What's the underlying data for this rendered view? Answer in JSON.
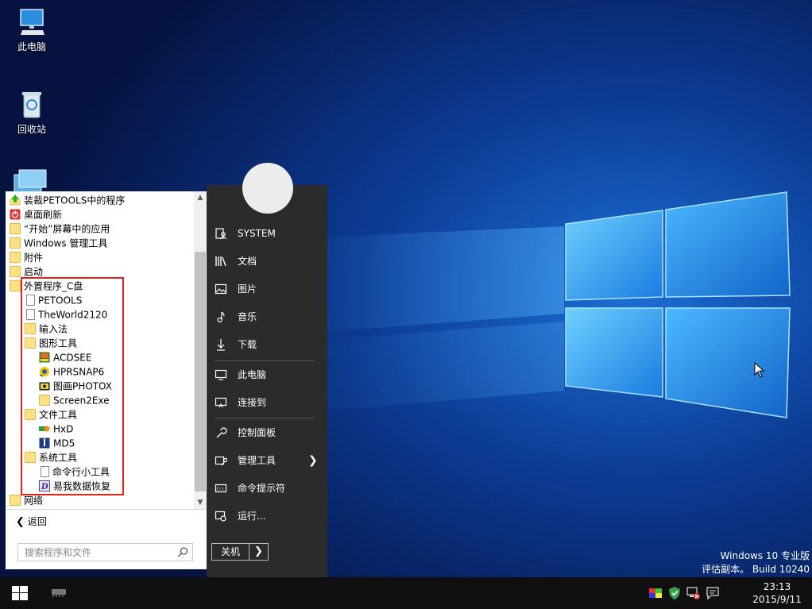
{
  "desktop": {
    "icons": [
      {
        "label": "此电脑",
        "icon": "computer-icon"
      },
      {
        "label": "回收站",
        "icon": "recycle-bin-icon"
      }
    ],
    "watermark": {
      "line1": "Windows 10 专业版",
      "line2": "评估副本。 Build 10240"
    }
  },
  "start_menu": {
    "left": {
      "items": [
        {
          "label": "装裁PETOOLS中的程序",
          "icon": "green-arrow-icon"
        },
        {
          "label": "桌面刷新",
          "icon": "red-power-icon"
        },
        {
          "label": "“开始”屏幕中的应用",
          "icon": "folder-icon"
        },
        {
          "label": "Windows 管理工具",
          "icon": "folder-icon"
        },
        {
          "label": "附件",
          "icon": "folder-icon"
        },
        {
          "label": "启动",
          "icon": "folder-icon"
        },
        {
          "label": "外置程序_C盘",
          "icon": "folder-icon"
        },
        {
          "label": "PETOOLS",
          "icon": "file-icon"
        },
        {
          "label": "TheWorld2120",
          "icon": "file-icon"
        },
        {
          "label": "输入法",
          "icon": "folder-icon"
        },
        {
          "label": "图形工具",
          "icon": "folder-icon"
        },
        {
          "label": "ACDSEE",
          "icon": "acdsee-icon"
        },
        {
          "label": "HPRSNAP6",
          "icon": "hprsnap-icon"
        },
        {
          "label": "图画PHOTOX",
          "icon": "photox-icon"
        },
        {
          "label": "Screen2Exe",
          "icon": "folder-icon"
        },
        {
          "label": "文件工具",
          "icon": "folder-icon"
        },
        {
          "label": "HxD",
          "icon": "hxd-icon"
        },
        {
          "label": "MD5",
          "icon": "md5-icon"
        },
        {
          "label": "系统工具",
          "icon": "folder-icon"
        },
        {
          "label": "命令行小工具",
          "icon": "file-icon"
        },
        {
          "label": "易我数据恢复",
          "icon": "easeus-icon"
        },
        {
          "label": "网络",
          "icon": "folder-icon"
        }
      ],
      "back_label": "返回",
      "search_placeholder": "搜索程序和文件"
    },
    "right": {
      "items": [
        {
          "label": "SYSTEM",
          "icon": "user-folder-icon"
        },
        {
          "label": "文档",
          "icon": "library-icon"
        },
        {
          "label": "图片",
          "icon": "picture-icon"
        },
        {
          "label": "音乐",
          "icon": "music-icon"
        },
        {
          "label": "下载",
          "icon": "download-icon"
        },
        {
          "label": "此电脑",
          "icon": "computer-icon"
        },
        {
          "label": "连接到",
          "icon": "connect-icon"
        },
        {
          "label": "控制面板",
          "icon": "wrench-icon"
        },
        {
          "label": "管理工具",
          "icon": "admin-tools-icon"
        },
        {
          "label": "命令提示符",
          "icon": "cmd-icon"
        },
        {
          "label": "运行...",
          "icon": "run-icon"
        }
      ],
      "shutdown_label": "关机"
    }
  },
  "taskbar": {
    "clock_time": "23:13",
    "clock_date": "2015/9/11",
    "tray_icons": [
      "color-icon",
      "shield-icon",
      "network-error-icon",
      "notification-icon"
    ]
  },
  "colors": {
    "annotation_red": "#e2231a",
    "menu_dark": "#2b2b2b",
    "taskbar": "#101010"
  }
}
